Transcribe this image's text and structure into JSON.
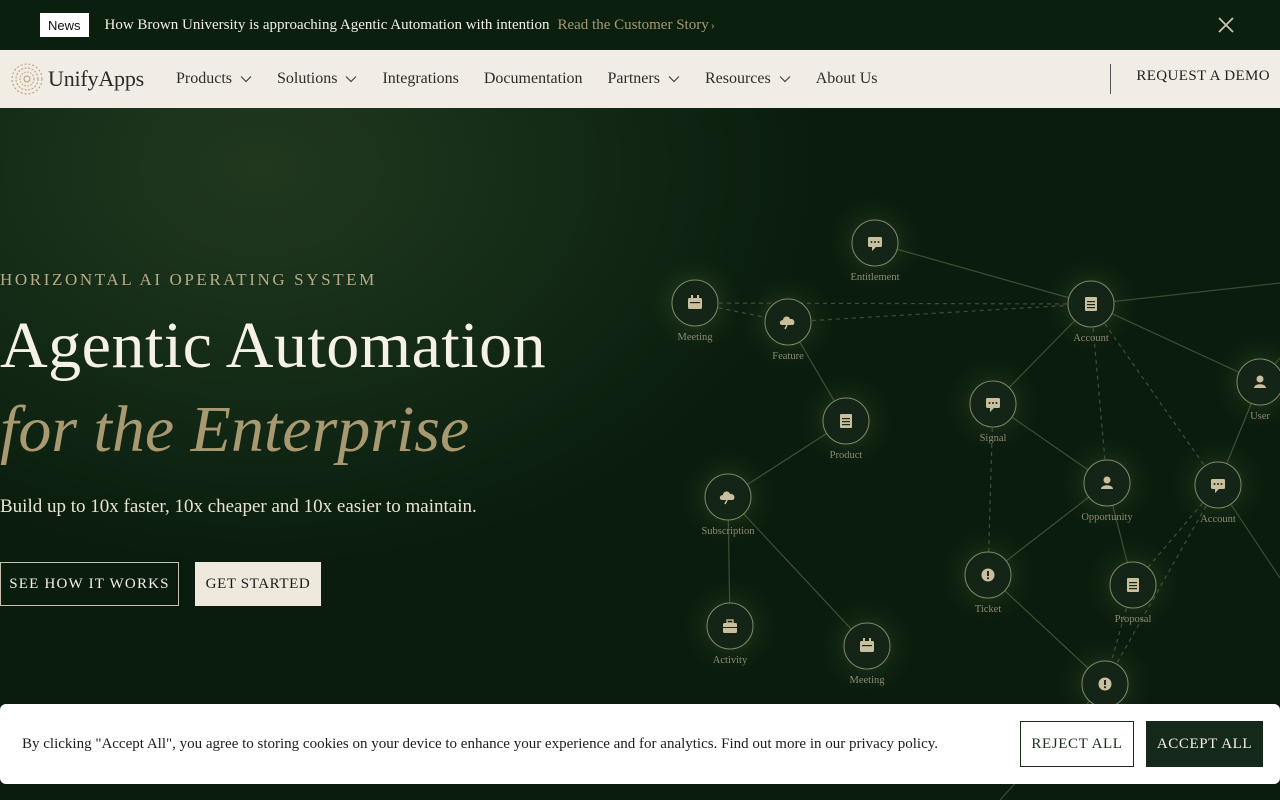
{
  "news": {
    "badge": "News",
    "text": "How Brown University is approaching Agentic Automation with intention",
    "link": "Read the Customer Story",
    "close_icon": "close-icon"
  },
  "nav": {
    "logo": "UnifyApps",
    "items": [
      {
        "label": "Products",
        "dropdown": true
      },
      {
        "label": "Solutions",
        "dropdown": true
      },
      {
        "label": "Integrations",
        "dropdown": false
      },
      {
        "label": "Documentation",
        "dropdown": false
      },
      {
        "label": "Partners",
        "dropdown": true
      },
      {
        "label": "Resources",
        "dropdown": true
      },
      {
        "label": "About Us",
        "dropdown": false
      }
    ],
    "cta": "REQUEST A DEMO"
  },
  "hero": {
    "eyebrow": "HORIZONTAL AI OPERATING SYSTEM",
    "headline": "Agentic Automation",
    "headline_italic": "for the Enterprise",
    "subline": "Build up to 10x faster, 10x cheaper and 10x easier to maintain.",
    "primary_cta": "SEE HOW IT WORKS",
    "secondary_cta": "GET STARTED"
  },
  "network_nodes": [
    {
      "label": "Entitlement",
      "icon": "chat-icon"
    },
    {
      "label": "Meeting",
      "icon": "calendar-icon"
    },
    {
      "label": "Feature",
      "icon": "cloud-icon"
    },
    {
      "label": "Account",
      "icon": "document-icon"
    },
    {
      "label": "User",
      "icon": "person-icon"
    },
    {
      "label": "Signal",
      "icon": "chat-icon"
    },
    {
      "label": "Product",
      "icon": "document-icon"
    },
    {
      "label": "Subscription",
      "icon": "cloud-icon"
    },
    {
      "label": "Opportunity",
      "icon": "person-icon"
    },
    {
      "label": "Account",
      "icon": "chat-icon"
    },
    {
      "label": "Ticket",
      "icon": "alert-icon"
    },
    {
      "label": "Proposal",
      "icon": "document-icon"
    },
    {
      "label": "Activity",
      "icon": "briefcase-icon"
    },
    {
      "label": "Meeting",
      "icon": "calendar-icon"
    },
    {
      "label": "",
      "icon": "alert-icon"
    }
  ],
  "cookie": {
    "text": "By clicking \"Accept All\", you agree to storing cookies on your device to enhance your experience and for analytics. Find out more in our privacy policy.",
    "reject": "REJECT ALL",
    "accept": "ACCEPT ALL"
  },
  "colors": {
    "background": "#0b1d0f",
    "nav_bg": "#f2ede4",
    "accent_gold": "#a89970",
    "cream": "#efe9dd",
    "dark_green": "#15291a"
  }
}
